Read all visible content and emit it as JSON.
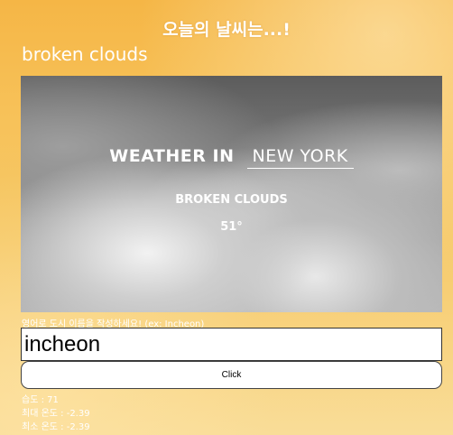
{
  "header": {
    "title": "오늘의 날씨는...!",
    "description": "broken clouds"
  },
  "weather_image": {
    "title_prefix": "WEATHER IN",
    "city": "NEW YORK",
    "condition": "BROKEN CLOUDS",
    "temperature": "51°"
  },
  "form": {
    "label": "영어로 도시 이름을 작성하세요! (ex: Incheon)",
    "input_value": "incheon",
    "button_label": "Click"
  },
  "results": {
    "humidity": "습도 : 71",
    "max_temp": "최대 온도 : -2.39",
    "min_temp": "최소 온도 : -2.39"
  }
}
